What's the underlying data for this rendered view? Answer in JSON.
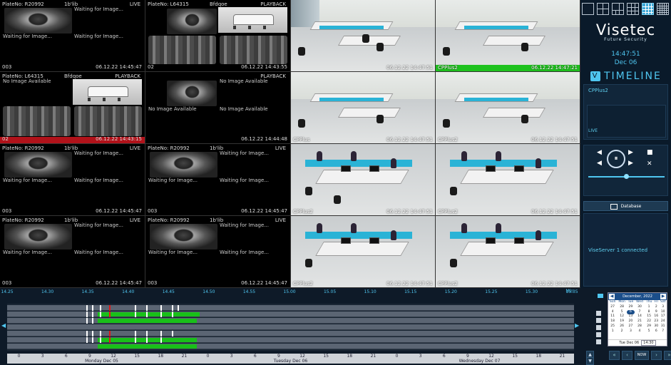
{
  "tiles": [
    {
      "plate": "PlateNo: R20992",
      "owner": "1b'lib",
      "mode": "LIVE",
      "waits": [
        "Waiting for Image...",
        "Waiting for Image...",
        "Waiting for Image..."
      ],
      "channel": "003",
      "time": "06.12.22 14:45:47"
    },
    {
      "plate": "PlateNo: L64315",
      "owner": "Bfdqoe",
      "mode": "PLAYBACK",
      "waits": [],
      "channel": "02",
      "time": "06.12.22 14:43:55"
    },
    {
      "plate": "PlateNo: L64315",
      "owner": "Bfdqoe",
      "mode": "PLAYBACK",
      "waits": [
        "No Image Available"
      ],
      "channel": "02",
      "time": "06.12.22 14:43:15"
    },
    {
      "plate": "",
      "owner": "",
      "mode": "PLAYBACK",
      "waits": [
        "No Image Available",
        "No Image Available",
        "No Image Available"
      ],
      "channel": "",
      "time": "06.12.22 14:44:48"
    },
    {
      "plate": "PlateNo: R20992",
      "owner": "1b'lib",
      "mode": "LIVE",
      "waits": [
        "Waiting for Image...",
        "Waiting for Image...",
        "Waiting for Image..."
      ],
      "channel": "003",
      "time": "06.12.22 14:45:47"
    },
    {
      "plate": "PlateNo: R20992",
      "owner": "1b'lib",
      "mode": "LIVE",
      "waits": [
        "Waiting for Image...",
        "Waiting for Image...",
        "Waiting for Image..."
      ],
      "channel": "003",
      "time": "06.12.22 14:45:47"
    },
    {
      "plate": "PlateNo: R20992",
      "owner": "1b'lib",
      "mode": "LIVE",
      "waits": [
        "Waiting for Image...",
        "Waiting for Image...",
        "Waiting for Image..."
      ],
      "channel": "003",
      "time": "06.12.22 14:45:47"
    },
    {
      "plate": "PlateNo: R20992",
      "owner": "1b'lib",
      "mode": "LIVE",
      "waits": [
        "Waiting for Image...",
        "Waiting for Image...",
        "Waiting for Image..."
      ],
      "channel": "003",
      "time": "06.12.22 14:45:47"
    }
  ],
  "cams": [
    {
      "label": "",
      "time": "06.12.22 14:47:51"
    },
    {
      "label": "CPPlus2",
      "time": "06.12.22 14:47:21"
    },
    {
      "label": "CPPlus",
      "time": "06.12.22 14:47:51"
    },
    {
      "label": "CPPlus2",
      "time": "06.12.22 14:47:51"
    },
    {
      "label": "CPPlus2",
      "time": "06.12.22 14:47:51"
    },
    {
      "label": "CPPlus2",
      "time": "06.12.22 14:47:51"
    },
    {
      "label": "CPPlus2",
      "time": "06.12.22 14:47:51"
    },
    {
      "label": "CPPlus2",
      "time": "06.12.22 14:47:51"
    }
  ],
  "brand": {
    "name": "Visetec",
    "tagline": "Future Security"
  },
  "clock": {
    "time": "14:47:51",
    "date": "Dec 06"
  },
  "timeline_logo": {
    "mark": "V",
    "text": "TIMELINE"
  },
  "selected_camera": {
    "name": "CPPlus2",
    "status": "LIVE"
  },
  "controls": {
    "play": "⏸",
    "prev": "◀",
    "next": "▶",
    "stop": "■",
    "close": "✕"
  },
  "database_label": "Database",
  "log_message": "ViseServer 1 connected",
  "timeline": {
    "min_label": "Min",
    "ticks": [
      "14.25",
      "14.30",
      "14.35",
      "14.40",
      "14.45",
      "14.50",
      "14.55",
      "15.00",
      "15.05",
      "15.10",
      "15.15",
      "15.20",
      "15.25",
      "15.30",
      "15.35"
    ],
    "hour_ticks": [
      "0",
      "3",
      "6",
      "9",
      "12",
      "15",
      "18",
      "21",
      "0",
      "3",
      "6",
      "9",
      "12",
      "15",
      "18",
      "21",
      "0",
      "3",
      "6",
      "9",
      "12",
      "15",
      "18",
      "21"
    ],
    "days": [
      "Monday Dec 05",
      "Tuesday Dec 06",
      "Wednesday Dec 07"
    ],
    "lanes": [
      {
        "segments": [],
        "marks": [
          {
            "at": 0.14,
            "r": false
          },
          {
            "at": 0.15,
            "r": false
          },
          {
            "at": 0.163,
            "r": false
          },
          {
            "at": 0.18,
            "r": true
          },
          {
            "at": 0.225,
            "r": false
          },
          {
            "at": 0.245,
            "r": false
          },
          {
            "at": 0.27,
            "r": false
          },
          {
            "at": 0.29,
            "r": false
          },
          {
            "at": 0.3,
            "r": false
          }
        ]
      },
      {
        "segments": [
          [
            0.16,
            0.34
          ]
        ],
        "marks": [
          {
            "at": 0.14,
            "r": false
          },
          {
            "at": 0.15,
            "r": false
          },
          {
            "at": 0.163,
            "r": false
          },
          {
            "at": 0.18,
            "r": true
          },
          {
            "at": 0.225,
            "r": false
          },
          {
            "at": 0.245,
            "r": false
          },
          {
            "at": 0.27,
            "r": false
          },
          {
            "at": 0.29,
            "r": false
          }
        ]
      },
      {
        "segments": [
          [
            0.16,
            0.335
          ]
        ],
        "marks": [
          {
            "at": 0.14,
            "r": false
          },
          {
            "at": 0.15,
            "r": false
          }
        ]
      },
      {
        "segments": [],
        "marks": []
      },
      {
        "segments": [],
        "marks": [
          {
            "at": 0.14,
            "r": false
          },
          {
            "at": 0.15,
            "r": false
          },
          {
            "at": 0.163,
            "r": false
          },
          {
            "at": 0.18,
            "r": true
          },
          {
            "at": 0.225,
            "r": false
          },
          {
            "at": 0.245,
            "r": false
          },
          {
            "at": 0.27,
            "r": false
          },
          {
            "at": 0.29,
            "r": false
          }
        ]
      },
      {
        "segments": [
          [
            0.16,
            0.335
          ]
        ],
        "marks": [
          {
            "at": 0.14,
            "r": false
          },
          {
            "at": 0.15,
            "r": false
          },
          {
            "at": 0.163,
            "r": false
          },
          {
            "at": 0.18,
            "r": true
          },
          {
            "at": 0.225,
            "r": false
          },
          {
            "at": 0.245,
            "r": false
          },
          {
            "at": 0.27,
            "r": false
          }
        ]
      },
      {
        "segments": [
          [
            0.16,
            0.335
          ]
        ],
        "marks": []
      }
    ]
  },
  "calendar": {
    "month": "December, 2022",
    "weekdays": [
      "Sun",
      "Mon",
      "Tue",
      "Wed",
      "Thu",
      "Fri",
      "Sat"
    ],
    "weeks": [
      [
        "27",
        "28",
        "29",
        "30",
        "1",
        "2",
        "3"
      ],
      [
        "4",
        "5",
        "6",
        "7",
        "8",
        "9",
        "10"
      ],
      [
        "11",
        "12",
        "13",
        "14",
        "15",
        "16",
        "17"
      ],
      [
        "18",
        "19",
        "20",
        "21",
        "22",
        "23",
        "24"
      ],
      [
        "25",
        "26",
        "27",
        "28",
        "29",
        "30",
        "31"
      ],
      [
        "1",
        "2",
        "3",
        "4",
        "5",
        "6",
        "7"
      ]
    ],
    "selected": "6",
    "footer_date": "Tue Dec 06",
    "footer_time": "14:30"
  },
  "nav_buttons": {
    "first": "«",
    "prev": "‹",
    "now": "NOW",
    "next": "›",
    "last": "»"
  }
}
